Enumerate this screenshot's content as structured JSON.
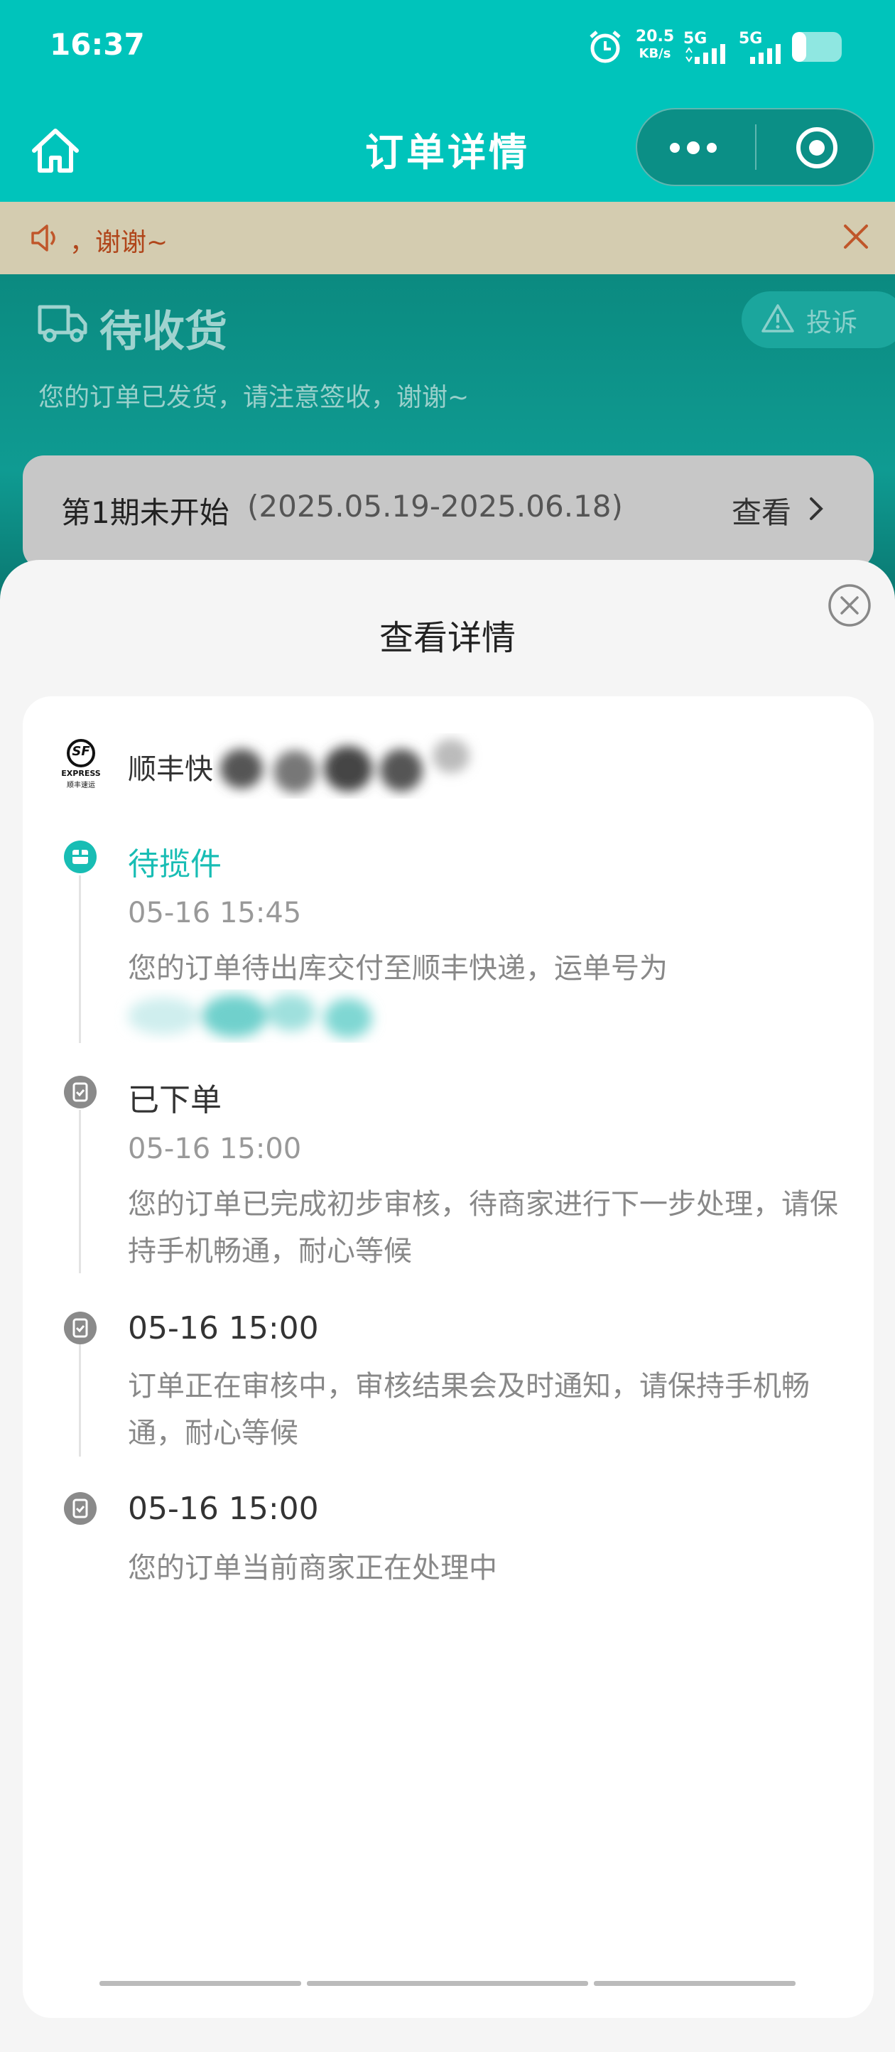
{
  "status_bar": {
    "time": "16:37",
    "net_speed": "20.5",
    "net_unit": "KB/s",
    "sim1": "5G",
    "sim2": "5G"
  },
  "nav": {
    "title": "订单详情"
  },
  "notice": {
    "text": "，谢谢~"
  },
  "order": {
    "status_title": "待收货",
    "status_desc": "您的订单已发货，请注意签收，谢谢~",
    "complaint_label": "投诉",
    "period_label": "第1期未开始",
    "period_range": "(2025.05.19-2025.06.18)",
    "period_view": "查看"
  },
  "sheet": {
    "title": "查看详情",
    "carrier_name": "顺丰快递",
    "logo_text_top": "SF",
    "logo_text_mid": "EXPRESS",
    "logo_text_bottom": "顺丰速运",
    "events": [
      {
        "title": "待揽件",
        "time": "05-16 15:45",
        "desc": "您的订单待出库交付至顺丰快递，运单号为"
      },
      {
        "title": "已下单",
        "time": "05-16 15:00",
        "desc": "您的订单已完成初步审核，待商家进行下一步处理，请保持手机畅通，耐心等候"
      },
      {
        "title": "05-16 15:00",
        "desc": "订单正在审核中，审核结果会及时通知，请保持手机畅通，耐心等候"
      },
      {
        "title": "05-16 15:00",
        "desc": "您的订单当前商家正在处理中"
      }
    ]
  },
  "colors": {
    "brand_teal": "#00c4bb",
    "active_event": "#18bdb4",
    "notice_text": "#b0451a"
  }
}
